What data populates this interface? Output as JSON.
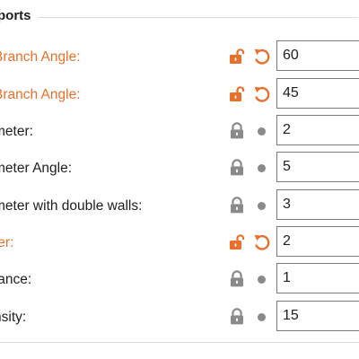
{
  "section": {
    "title": "ports"
  },
  "colors": {
    "modified_accent": "#e8702a",
    "lock_gray": "#8a8a8a",
    "text": "#202020"
  },
  "rows": [
    {
      "label": "Branch Angle:",
      "value": "60",
      "modified": true,
      "lock_icon": "unlock-icon",
      "reset_icon": "reset-icon"
    },
    {
      "label": "Branch Angle:",
      "value": "45",
      "modified": true,
      "lock_icon": "unlock-icon",
      "reset_icon": "reset-icon"
    },
    {
      "label": "meter:",
      "value": "2",
      "modified": false,
      "lock_icon": "lock-icon"
    },
    {
      "label": "meter Angle:",
      "value": "5",
      "modified": false,
      "lock_icon": "lock-icon"
    },
    {
      "label": "meter with double walls:",
      "value": "3",
      "modified": false,
      "lock_icon": "lock-icon"
    },
    {
      "label": "ter:",
      "value": "2",
      "modified": true,
      "lock_icon": "unlock-icon",
      "reset_icon": "reset-icon"
    },
    {
      "label": "tance:",
      "value": "1",
      "modified": false,
      "lock_icon": "lock-icon"
    },
    {
      "label": "nsity:",
      "value": "15",
      "modified": false,
      "lock_icon": "lock-icon"
    }
  ]
}
